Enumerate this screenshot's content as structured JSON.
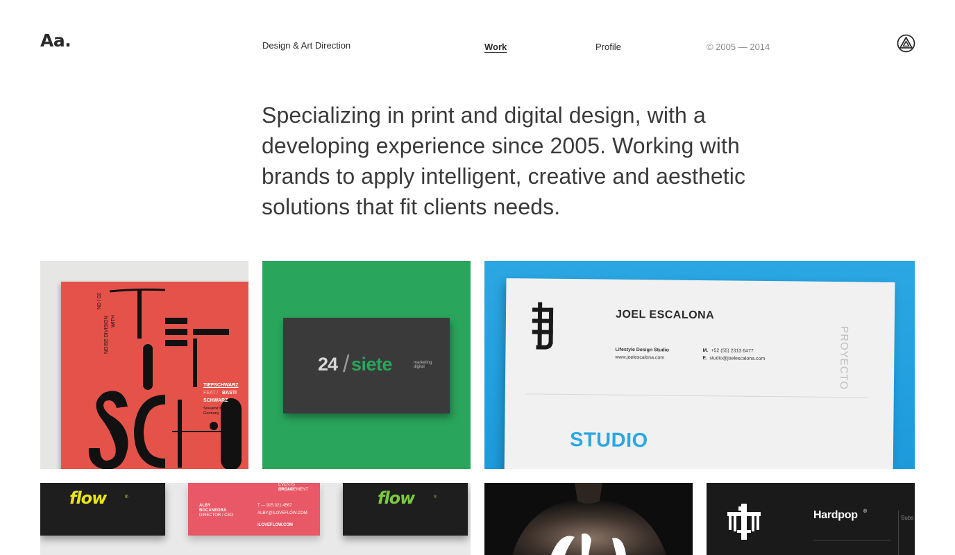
{
  "header": {
    "logo": "Aa.",
    "tagline": "Design & Art Direction",
    "nav": {
      "work": "Work",
      "profile": "Profile"
    },
    "copyright": "© 2005 — 2014",
    "mark_icon": "triangle-in-circle-icon"
  },
  "intro": {
    "text": "Specializing in print and digital design, with a developing experience since 2005. Working with brands to apply intelligent, creative and aesthetic solutions that fit clients needs."
  },
  "projects": {
    "tiefschwarz": {
      "line1": "ND / 02",
      "line2": "NOISE DIVISION",
      "line3": "WITH",
      "name1": "TIEFSCHWARZ",
      "feat": "FEAT /",
      "name2": "BASTI",
      "name3": "SCHWARZ",
      "meta1": "Souvenir Music",
      "meta2": "Germany"
    },
    "siete": {
      "num": "24",
      "slash": "/",
      "word": "siete",
      "small1": "marketing",
      "small2": "digital"
    },
    "letterhead": {
      "name": "JOEL ESCALONA",
      "studio_line": "Lifestyle Design Studio",
      "web": "www.joelescalona.com",
      "phone_label": "M.",
      "phone": "+52 (55) 2313 6477",
      "email_label": "E.",
      "email": "studio@joelescalona.com",
      "vertical": "PROYECTO",
      "big": "STUDIO"
    },
    "flow": {
      "word": "flow",
      "reg": "®",
      "pink_top": "EVENTS MANAGEMENT",
      "pink_top2": "GROUP",
      "person": "ALBY",
      "person2": "BOCANEGRA",
      "role": "DIRECTOR / CEO",
      "phone": "T — 915.321.4567",
      "email": "ALBY@ILOVEFLOW.COM",
      "site": "ILOVEFLOW.COM"
    },
    "hardpop": {
      "word": "Hardpop",
      "reg": "®",
      "sub": "Subs"
    }
  },
  "colors": {
    "text": "#2b2b2b",
    "muted": "#8a8a8a",
    "poster_red": "#e4524a",
    "siete_green": "#2aa55c",
    "studio_blue": "#2ba7e3",
    "flow_yellow": "#e8e417",
    "flow_green": "#7ac943",
    "flow_pink": "#e85866"
  }
}
